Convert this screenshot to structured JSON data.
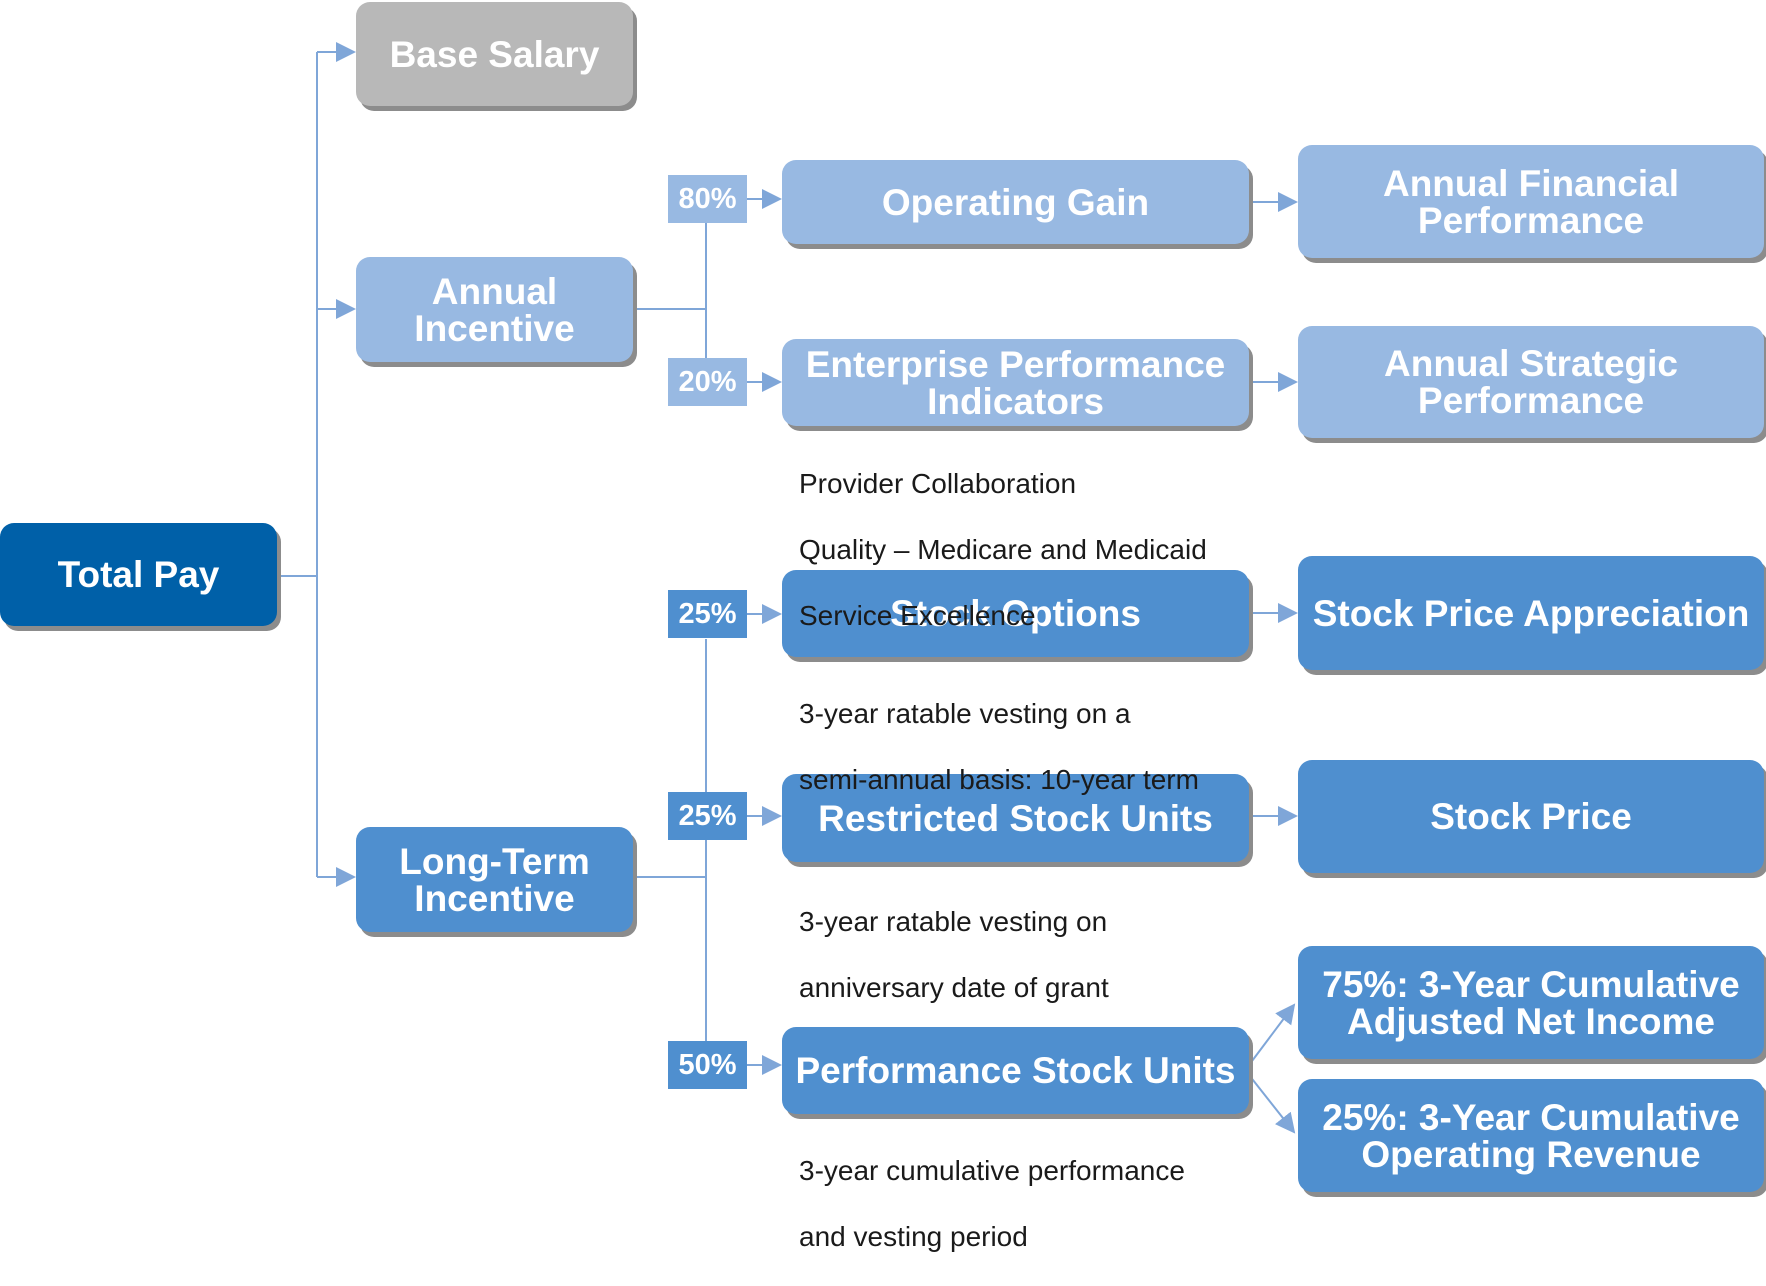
{
  "colors": {
    "dark": "#0060a8",
    "mid": "#4f8fcf",
    "light": "#98b9e2",
    "gray": "#b8b8b8",
    "connector": "#7fa6d8"
  },
  "root": "Total Pay",
  "level1": {
    "base_salary": "Base Salary",
    "annual_incentive": "Annual Incentive",
    "long_term_incentive": "Long-Term Incentive"
  },
  "annual": {
    "operating_gain": {
      "pct": "80%",
      "label": "Operating Gain",
      "metric": "Annual Financial Performance"
    },
    "epi": {
      "pct": "20%",
      "label": "Enterprise Performance Indicators",
      "metric": "Annual Strategic Performance",
      "notes": [
        "Provider Collaboration",
        "Quality – Medicare and Medicaid",
        "Service Excellence"
      ]
    }
  },
  "lti": {
    "stock_options": {
      "pct": "25%",
      "label": "Stock Options",
      "metric": "Stock Price Appreciation",
      "notes": [
        "3-year ratable vesting on a",
        "semi-annual basis: 10-year term"
      ]
    },
    "rsu": {
      "pct": "25%",
      "label": "Restricted Stock Units",
      "metric": "Stock Price",
      "notes": [
        "3-year ratable vesting on",
        "anniversary date of grant"
      ]
    },
    "psu": {
      "pct": "50%",
      "label": "Performance Stock Units",
      "metrics": [
        "75%: 3-Year Cumulative Adjusted Net Income",
        "25%: 3-Year Cumulative Operating Revenue"
      ],
      "notes": [
        "3-year cumulative performance",
        "and vesting period"
      ]
    }
  }
}
